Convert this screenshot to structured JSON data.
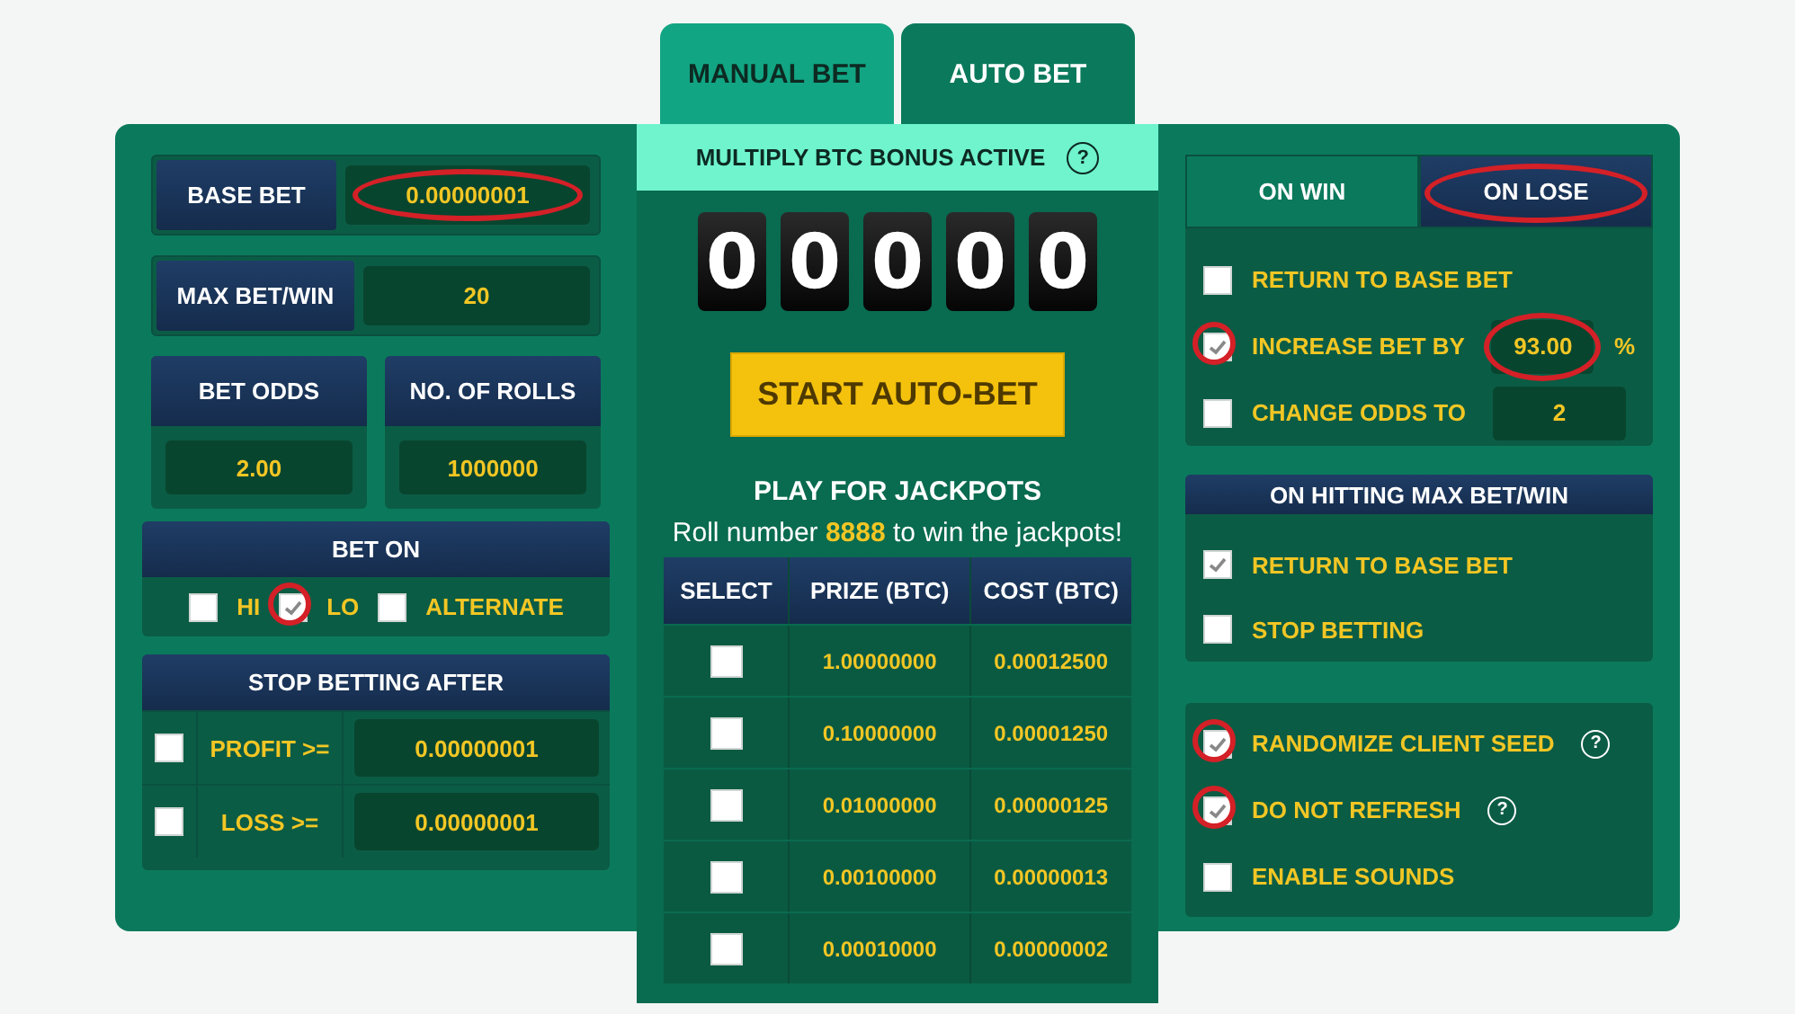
{
  "tabs": [
    {
      "label": "MANUAL BET",
      "selected": false
    },
    {
      "label": "AUTO BET",
      "selected": true
    }
  ],
  "settings": {
    "base_bet": {
      "label": "BASE BET",
      "value": "0.00000001",
      "circled": true
    },
    "max_bet_win": {
      "label": "MAX BET/WIN",
      "value": "20"
    },
    "cards": [
      {
        "label": "BET ODDS",
        "value": "2.00"
      },
      {
        "label": "NO. OF ROLLS",
        "value": "1000000"
      }
    ],
    "bet_on": {
      "title": "BET ON",
      "options": [
        {
          "label": "HI",
          "checked": false
        },
        {
          "label": "LO",
          "checked": true,
          "circled": true
        },
        {
          "label": "ALTERNATE",
          "checked": false
        }
      ]
    },
    "stop_betting": {
      "title": "STOP BETTING AFTER",
      "rows": [
        {
          "label": "PROFIT >=",
          "checked": false,
          "value": "0.00000001"
        },
        {
          "label": "LOSS >=",
          "checked": false,
          "value": "0.00000001"
        }
      ]
    }
  },
  "center": {
    "bonus": {
      "text": "MULTIPLY BTC BONUS ACTIVE",
      "help": "?"
    },
    "digits": [
      "0",
      "0",
      "0",
      "0",
      "0"
    ],
    "start_button": "START AUTO-BET",
    "jackpot_title": "PLAY FOR JACKPOTS",
    "jackpot_text": "Roll number **8888** to win the jackpots!",
    "table": {
      "columns": [
        "SELECT",
        "PRIZE (BTC)",
        "COST (BTC)"
      ],
      "rows": [
        {
          "checked": false,
          "prize": "1.00000000",
          "cost": "0.00012500"
        },
        {
          "checked": false,
          "prize": "0.10000000",
          "cost": "0.00001250"
        },
        {
          "checked": false,
          "prize": "0.01000000",
          "cost": "0.00000125"
        },
        {
          "checked": false,
          "prize": "0.00100000",
          "cost": "0.00000013"
        },
        {
          "checked": false,
          "prize": "0.00010000",
          "cost": "0.00000002"
        }
      ]
    }
  },
  "outcome": {
    "tabs": [
      {
        "label": "ON WIN",
        "selected": false
      },
      {
        "label": "ON LOSE",
        "selected": true,
        "circled": true
      }
    ],
    "options": [
      {
        "kind": "plain",
        "label": "RETURN TO BASE BET",
        "checked": false
      },
      {
        "kind": "input",
        "label": "INCREASE BET BY",
        "checked": true,
        "circled": true,
        "value": "93.00",
        "value_circled": true,
        "suffix": "%"
      },
      {
        "kind": "input",
        "label": "CHANGE ODDS TO",
        "checked": false,
        "value": "2"
      }
    ]
  },
  "max_hit": {
    "title": "ON HITTING MAX BET/WIN",
    "options": [
      {
        "label": "RETURN TO BASE BET",
        "checked": true
      },
      {
        "label": "STOP BETTING",
        "checked": false
      }
    ]
  },
  "misc": [
    {
      "label": "RANDOMIZE CLIENT SEED",
      "checked": true,
      "circled": true,
      "help": "?"
    },
    {
      "label": "DO NOT REFRESH",
      "checked": true,
      "circled": true,
      "help": "?"
    },
    {
      "label": "ENABLE SOUNDS",
      "checked": false
    }
  ]
}
